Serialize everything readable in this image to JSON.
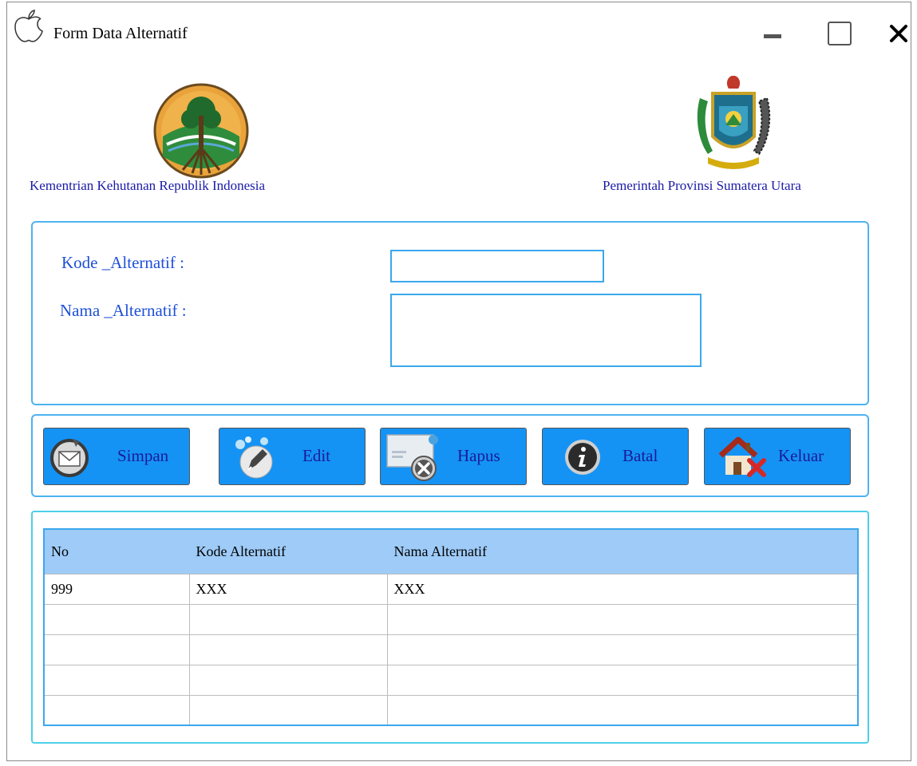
{
  "window": {
    "title": "Form Data Alternatif",
    "icon": "apple-icon"
  },
  "header": {
    "left_org": "Kementrian Kehutanan Republik Indonesia",
    "right_org": "Pemerintah Provinsi Sumatera Utara",
    "left_logo": "kementrian-kehutanan-emblem",
    "right_logo": "sumatera-utara-coat-of-arms"
  },
  "form": {
    "kode_label": "Kode _Alternatif :",
    "kode_value": "",
    "nama_label": "Nama _Alternatif :",
    "nama_value": ""
  },
  "buttons": {
    "simpan": "Simpan",
    "edit": "Edit",
    "hapus": "Hapus",
    "batal": "Batal",
    "keluar": "Keluar"
  },
  "table": {
    "columns": [
      "No",
      "Kode Alternatif",
      "Nama Alternatif"
    ],
    "rows": [
      [
        "999",
        "XXX",
        "XXX"
      ],
      [
        "",
        "",
        ""
      ],
      [
        "",
        "",
        ""
      ],
      [
        "",
        "",
        ""
      ],
      [
        "",
        "",
        ""
      ]
    ]
  },
  "colors": {
    "button_bg": "#1493f5",
    "button_text": "#1a1a99",
    "label_text": "#1e4fd8",
    "org_text": "#1a1aa8",
    "panel_border": "#4db3f0",
    "table_header_bg": "#9ecbf7"
  }
}
